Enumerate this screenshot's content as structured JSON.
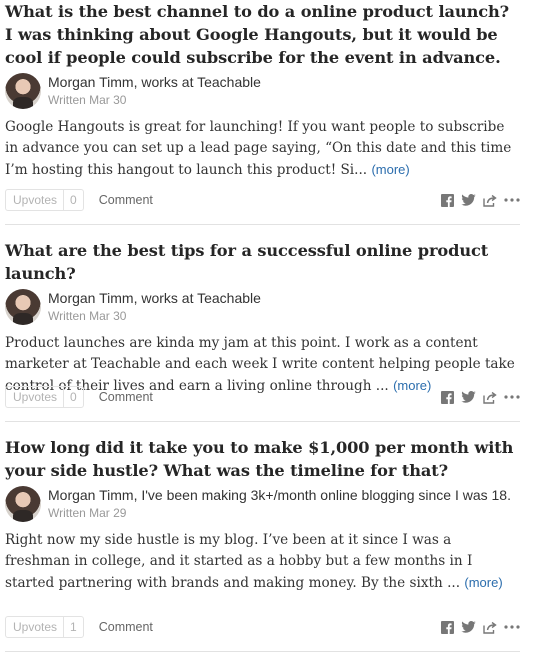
{
  "answers": [
    {
      "question": "What is the best channel to do a online product launch? I was thinking about Google Hangouts, but it would be cool if people could subscribe for the event in advance.",
      "author": "Morgan Timm, works at Teachable",
      "written": "Written Mar 30",
      "text": "Google Hangouts is great for launching! If you want people to subscribe in advance you can set up a lead page saying, “On this date and this time I’m hosting this hangout to launch this product! Si...",
      "more": "(more)",
      "upvote_label": "Upvotes",
      "upvote_count": "0",
      "comment_label": "Comment"
    },
    {
      "question": "What are the best tips for a successful online product launch?",
      "author": "Morgan Timm, works at Teachable",
      "written": "Written Mar 30",
      "text": "Product launches are kinda my jam at this point. I work as a content marketer at Teachable and each week I write content helping people take control of their lives and earn a living online through ...",
      "more": "(more)",
      "upvote_label": "Upvotes",
      "upvote_count": "0",
      "comment_label": "Comment"
    },
    {
      "question": "How long did it take you to make $1,000 per month with your side hustle? What was the timeline for that?",
      "author": "Morgan Timm, I've been making 3k+/month online blogging since I was 18.",
      "written": "Written Mar 29",
      "text": "Right now my side hustle is my blog. I’ve been at it since I was a freshman in college, and it started as a hobby but a few months in I started partnering with brands and making money. By the sixth ...",
      "more": "(more)",
      "upvote_label": "Upvotes",
      "upvote_count": "1",
      "comment_label": "Comment"
    }
  ],
  "icons": {
    "facebook": "facebook-icon",
    "twitter": "twitter-icon",
    "share": "share-icon",
    "overflow": "more-options-icon"
  },
  "colors": {
    "link": "#2b6dad",
    "meta": "#999999",
    "icon": "#777777"
  }
}
